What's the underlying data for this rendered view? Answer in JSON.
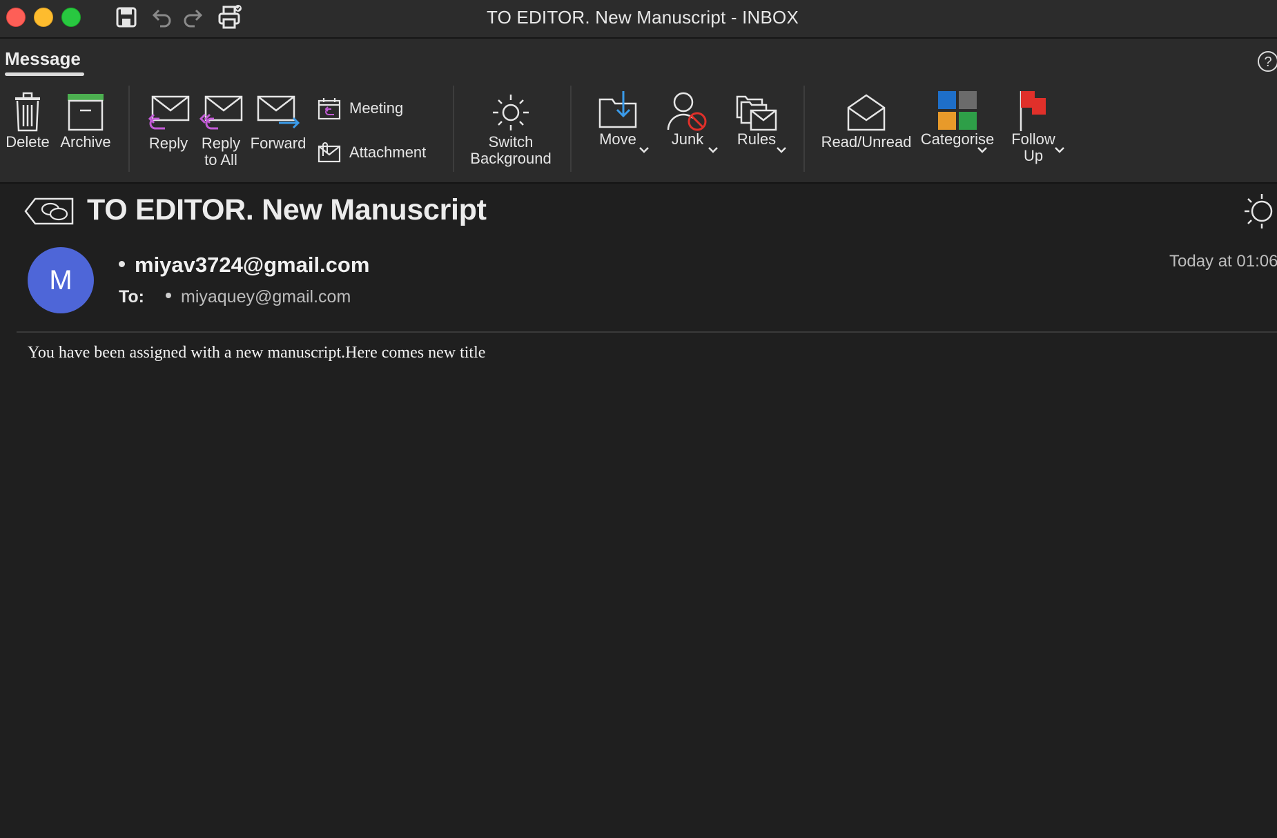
{
  "window": {
    "title": "TO EDITOR. New Manuscript - INBOX"
  },
  "quick_access": [
    "save-icon",
    "undo-icon",
    "redo-icon",
    "print-icon"
  ],
  "ribbon": {
    "tab": "Message",
    "buttons": {
      "delete": "Delete",
      "archive": "Archive",
      "reply": "Reply",
      "reply_all_line1": "Reply",
      "reply_all_line2": "to All",
      "forward": "Forward",
      "meeting": "Meeting",
      "attachment": "Attachment",
      "switch_bg_line1": "Switch",
      "switch_bg_line2": "Background",
      "move": "Move",
      "junk": "Junk",
      "rules": "Rules",
      "read_unread": "Read/Unread",
      "categorise": "Categorise",
      "follow_up_line1": "Follow",
      "follow_up_line2": "Up"
    }
  },
  "message": {
    "subject": "TO EDITOR. New Manuscript",
    "avatar_initial": "M",
    "sender": "miyav3724@gmail.com",
    "to_label": "To:",
    "recipient": "miyaquey@gmail.com",
    "date": "Today at 01:06",
    "body": "You have been assigned with a new manuscript.Here comes new title"
  },
  "colors": {
    "background": "#1f1f1f",
    "ribbon": "#2b2b2b",
    "avatar": "#4e66d8",
    "reply_arrow": "#c25bd6",
    "forward_arrow": "#3a9bea",
    "archive_bar": "#4caf50",
    "flag": "#e0302a",
    "junk_block": "#e0302a"
  }
}
